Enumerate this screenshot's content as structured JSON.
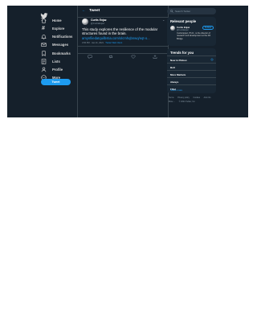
{
  "colors": {
    "background": "#15202b",
    "panel": "#192734",
    "accent": "#1d9bf0",
    "border": "#38444d",
    "muted": "#8899a6"
  },
  "nav": {
    "logo_icon": "twitter-bird-icon",
    "items": [
      {
        "label": "Home",
        "icon": "home-icon"
      },
      {
        "label": "Explore",
        "icon": "hashtag-icon"
      },
      {
        "label": "Notifications",
        "icon": "bell-icon"
      },
      {
        "label": "Messages",
        "icon": "envelope-icon"
      },
      {
        "label": "Bookmarks",
        "icon": "bookmark-icon"
      },
      {
        "label": "Lists",
        "icon": "list-icon"
      },
      {
        "label": "Profile",
        "icon": "person-icon"
      },
      {
        "label": "More",
        "icon": "more-circle-icon"
      }
    ],
    "tweet_button": "Tweet"
  },
  "main": {
    "title": "Tweet",
    "tweet": {
      "author_name": "Curtis Enjaz",
      "author_handle": "@CurtisEnjaz",
      "text": "This study explores the resilience of the modular structures found in the brain.",
      "link": "amynfiiedatquilbstia.com/olcmhqbnwq/eqt-o...",
      "time": "4:56 PM · Jan 21, 2021 ·",
      "source": "Twitter Web Client"
    }
  },
  "sidebar": {
    "search_placeholder": "Search Twitter",
    "relevant": {
      "title": "Relevant people",
      "name": "Curtis Enjaz",
      "handle": "@CurtisEnjaz",
      "follow": "Follow",
      "bio": "Curtis Enjaz, Ph.D., is the director of research and development at the 4th Bridge."
    },
    "trends": {
      "title": "Trends for you",
      "items": [
        "Now in Pinbox",
        "Bolt",
        "More Markets",
        "Always",
        "Fillet"
      ],
      "show_more": "Show more"
    },
    "footer": {
      "line1": [
        "Terms",
        "Privacy policy",
        "Cookies",
        "Ads info"
      ],
      "line2": [
        "More ...",
        "© 2021 Twitter, Inc."
      ]
    }
  }
}
